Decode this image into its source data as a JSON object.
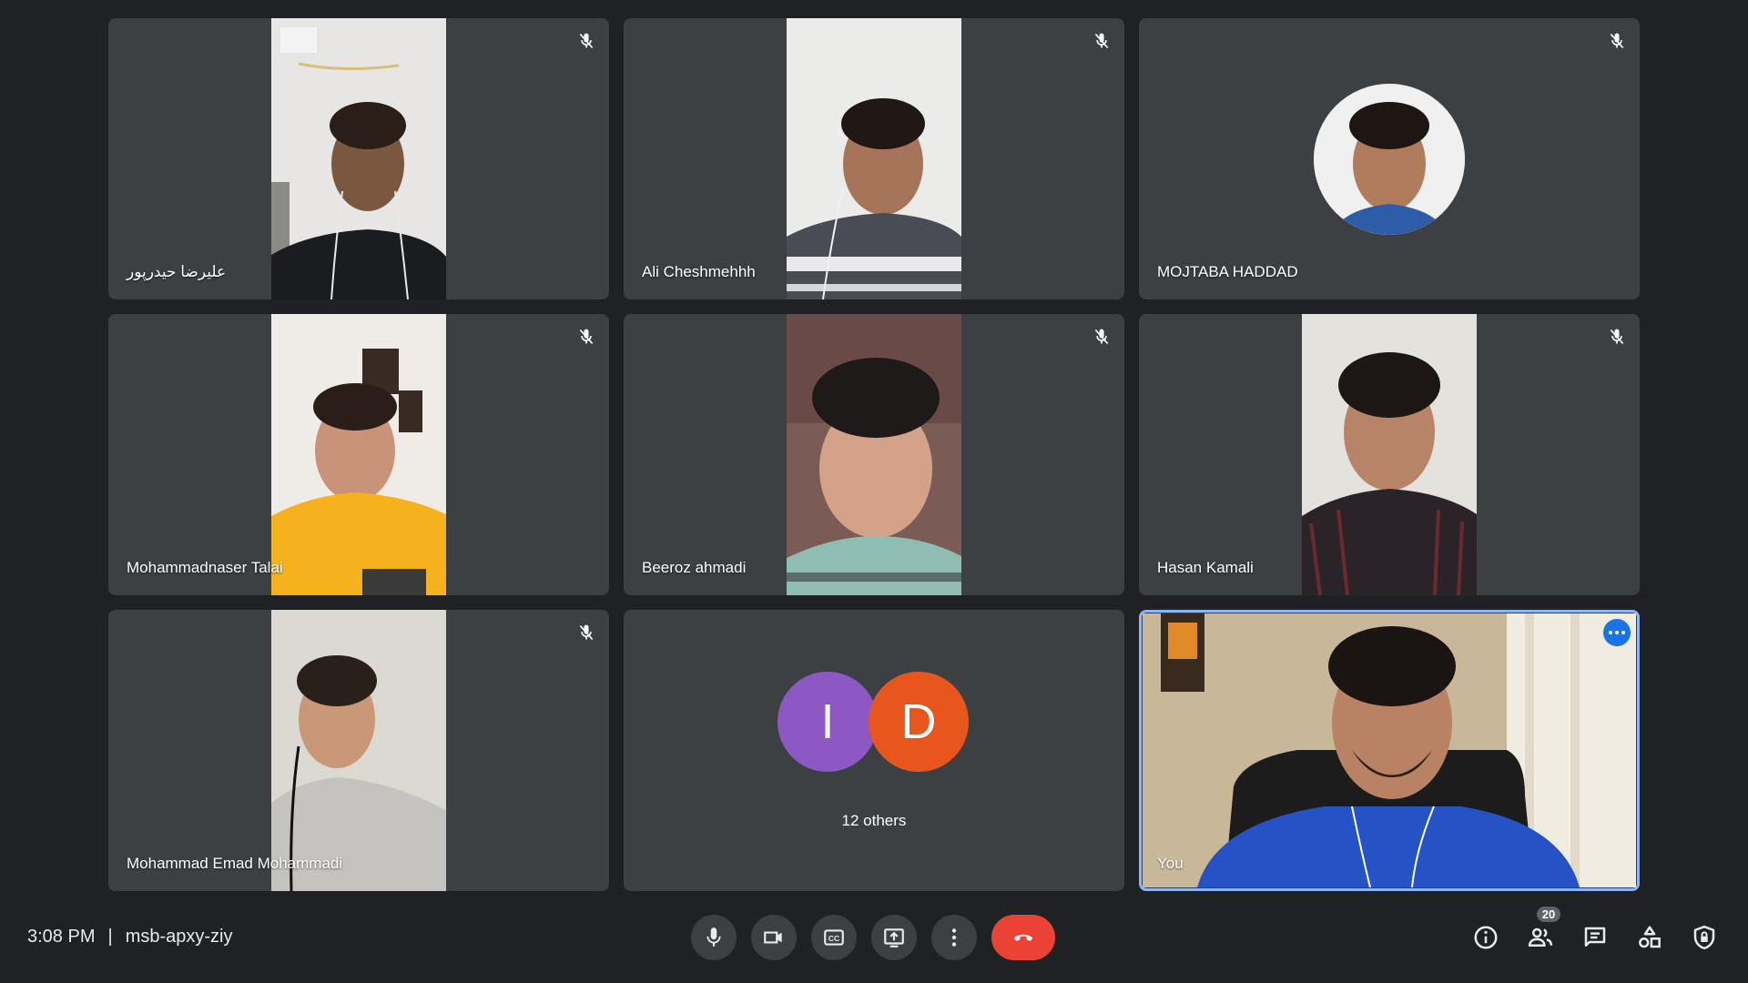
{
  "participants": [
    {
      "name": "علیرضا حیدرپور",
      "muted": true
    },
    {
      "name": "Ali Cheshmehhh",
      "muted": true
    },
    {
      "name": "MOJTABA HADDAD",
      "muted": true
    },
    {
      "name": "Mohammadnaser Talai",
      "muted": true
    },
    {
      "name": "Beeroz ahmadi",
      "muted": true
    },
    {
      "name": "Hasan Kamali",
      "muted": true
    },
    {
      "name": "Mohammad Emad Mohammadi",
      "muted": true
    }
  ],
  "others": {
    "avatars": [
      {
        "initial": "I",
        "color": "#8e58c4"
      },
      {
        "initial": "D",
        "color": "#e8561d"
      }
    ],
    "label": "12 others"
  },
  "self": {
    "name": "You",
    "highlight_color": "#8ab4f8"
  },
  "meeting": {
    "time": "3:08 PM",
    "separator": "|",
    "code": "msb-apxy-ziy"
  },
  "controls": {
    "mic_icon": "microphone-icon",
    "camera_icon": "camera-icon",
    "captions_icon": "captions-icon",
    "present_icon": "present-screen-icon",
    "more_icon": "more-options-icon",
    "end_icon": "end-call-icon",
    "end_color": "#ea4335"
  },
  "side": {
    "participant_count": "20"
  }
}
